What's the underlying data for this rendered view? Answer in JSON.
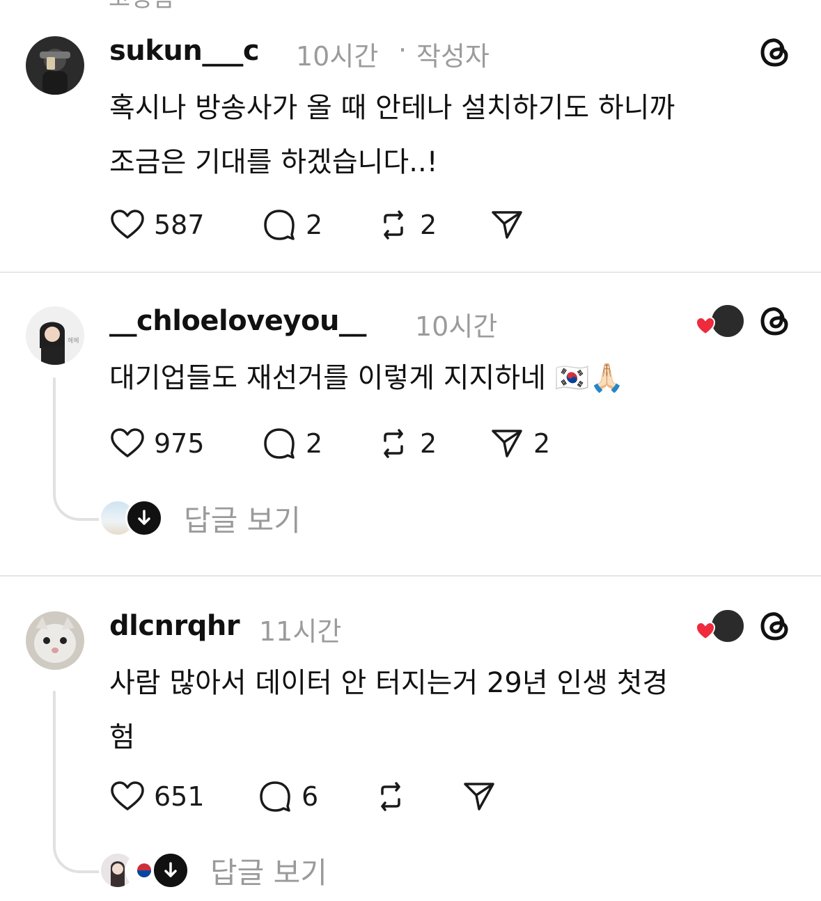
{
  "top_partial": {
    "label": "고정됨"
  },
  "posts": [
    {
      "username": "sukun___c",
      "time": "10시간",
      "separator": "·",
      "author_tag": "작성자",
      "lines": [
        "혹시나 방송사가 올 때 안테나 설치하기도 하니까",
        "조금은 기대를 하겠습니다..!"
      ],
      "likes": "587",
      "replies": "2",
      "reposts": "2",
      "shares": ""
    },
    {
      "username": "__chloeloveyou__",
      "time": "10시간",
      "lines": [
        "대기업들도 재선거를 이렇게 지지하네 🇰🇷🙏🏻"
      ],
      "likes": "975",
      "replies": "2",
      "reposts": "2",
      "shares": "2",
      "view_replies": "답글 보기"
    },
    {
      "username": "dlcnrqhr",
      "time": "11시간",
      "lines": [
        "사람 많아서 데이터 안 터지는거 29년 인생 첫경",
        "험"
      ],
      "likes": "651",
      "replies": "6",
      "reposts": "",
      "shares": "",
      "view_replies": "답글 보기"
    }
  ],
  "colors": {
    "text": "#111111",
    "muted": "#9b9b9b",
    "divider": "#e6e6e6",
    "heart": "#ee2a3c"
  },
  "icons": [
    "pin-icon",
    "threads-logo-icon",
    "heart-icon",
    "comment-icon",
    "repost-icon",
    "share-icon",
    "arrow-down-icon"
  ]
}
